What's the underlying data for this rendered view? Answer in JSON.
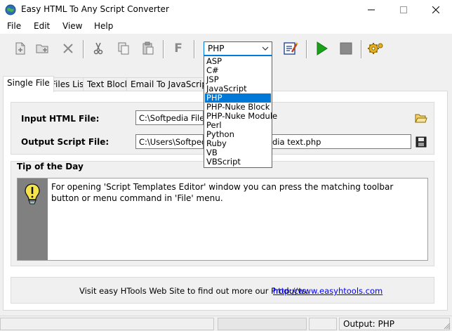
{
  "window": {
    "title": "Easy HTML To Any Script Converter"
  },
  "menu": [
    "File",
    "Edit",
    "View",
    "Help"
  ],
  "toolbar": {
    "format_button": "F",
    "language": {
      "selected": "PHP",
      "options": [
        "ASP",
        "C#",
        "JSP",
        "JavaScript",
        "PHP",
        "PHP-Nuke Block",
        "PHP-Nuke Module",
        "Perl",
        "Python",
        "Ruby",
        "VB",
        "VBScript"
      ]
    }
  },
  "tabs": [
    "Single File",
    "Files List",
    "Text Block",
    "Email To JavaScript"
  ],
  "input": {
    "label": "Input HTML File:",
    "value": "C:\\Softpedia Files\\S"
  },
  "output": {
    "label": "Output Script File:",
    "value": "C:\\Users\\Softpedia",
    "value_tail": "dia text.php"
  },
  "tip": {
    "title": "Tip of the Day",
    "text": "For opening 'Script Templates Editor' window you can press the matching toolbar button or menu command in 'File' menu."
  },
  "footer": {
    "text": "Visit easy HTools Web Site to find out more our Products:",
    "link": "http://www.easyhtools.com"
  },
  "status": {
    "output": "Output: PHP"
  },
  "colors": {
    "accent": "#0078d7",
    "run_green": "#1aa01a",
    "link": "#0000ff"
  }
}
